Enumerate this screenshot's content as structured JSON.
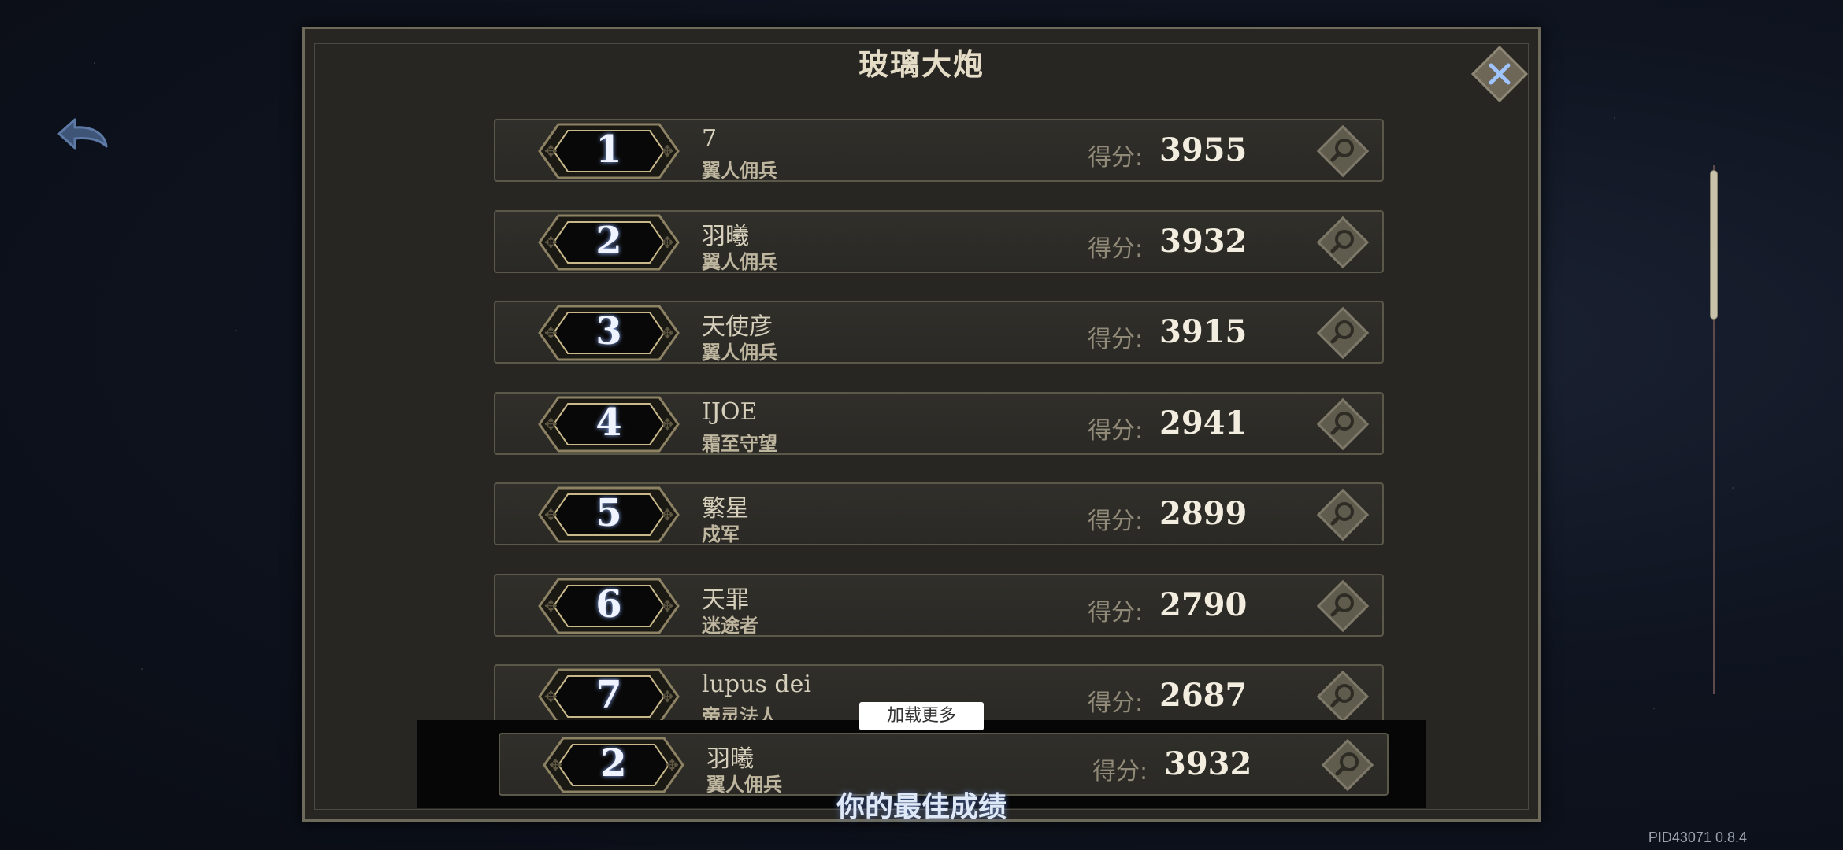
{
  "title": "玻璃大炮",
  "score_label": "得分:",
  "rows": [
    {
      "rank": "1",
      "name": "7",
      "class": "翼人佣兵",
      "score": "3955"
    },
    {
      "rank": "2",
      "name": "羽曦",
      "class": "翼人佣兵",
      "score": "3932"
    },
    {
      "rank": "3",
      "name": "天使彦",
      "class": "翼人佣兵",
      "score": "3915"
    },
    {
      "rank": "4",
      "name": "IJOE",
      "class": "霜至守望",
      "score": "2941"
    },
    {
      "rank": "5",
      "name": "繁星",
      "class": "戍军",
      "score": "2899"
    },
    {
      "rank": "6",
      "name": "天罪",
      "class": "迷途者",
      "score": "2790"
    },
    {
      "rank": "7",
      "name": "lupus dei",
      "class": "帝灵法人",
      "score": "2687"
    }
  ],
  "load_more_label": "加载更多",
  "best": {
    "rank": "2",
    "name": "羽曦",
    "class": "翼人佣兵",
    "score": "3932",
    "caption": "你的最佳成绩"
  },
  "version": "PID43071  0.8.4",
  "icons": {
    "back": "back-arrow-icon",
    "close": "close-icon",
    "inspect": "magnifier-icon"
  },
  "colors": {
    "panel": "#272622",
    "accent_blue": "#8fb0ff",
    "border_gold": "#6d6a5c"
  }
}
